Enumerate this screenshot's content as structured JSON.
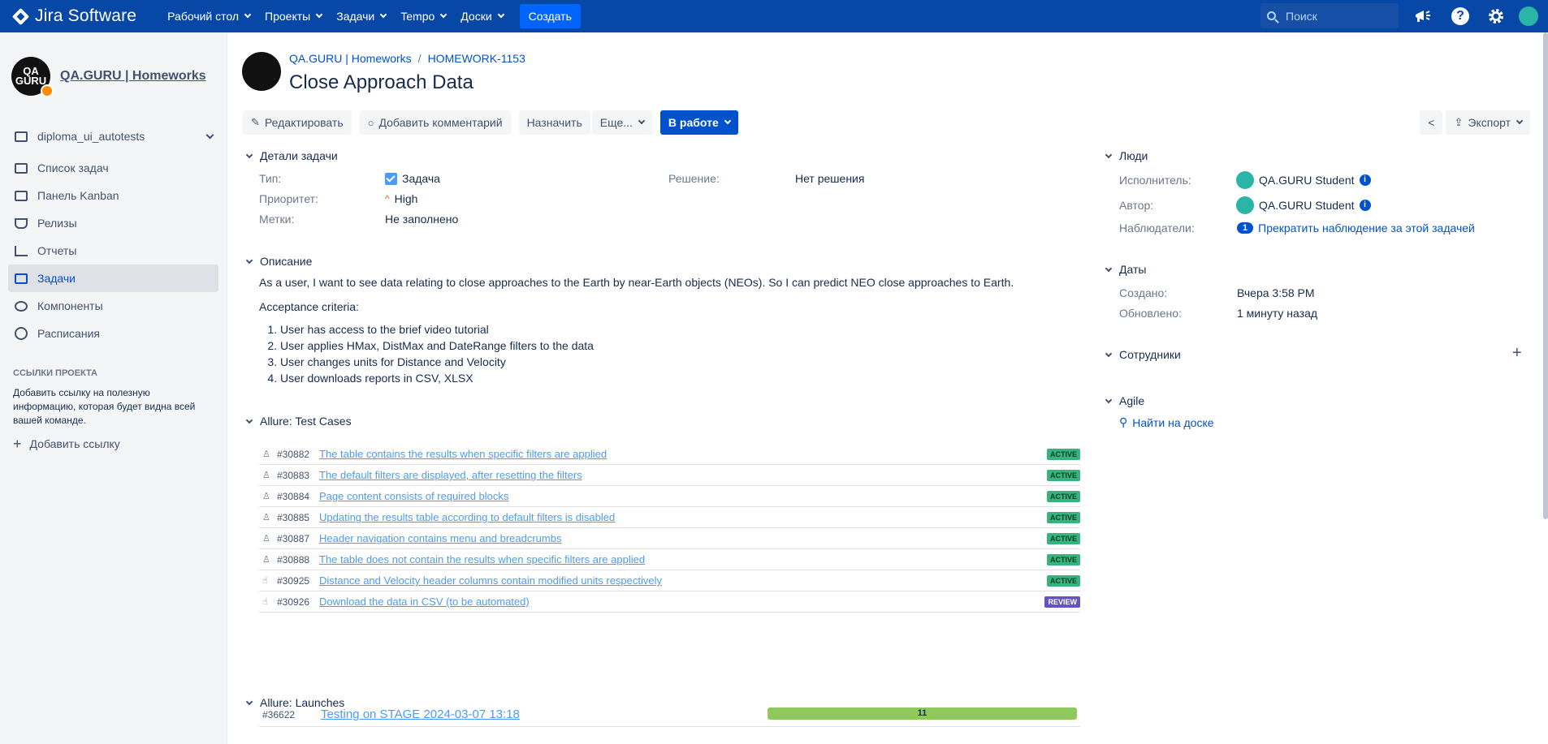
{
  "topbar": {
    "brand": "Jira Software",
    "nav": [
      "Рабочий стол",
      "Проекты",
      "Задачи",
      "Tempo",
      "Доски"
    ],
    "create_label": "Создать",
    "search_placeholder": "Поиск"
  },
  "sidebar": {
    "project_name": "QA.GURU | Homeworks",
    "board_name": "diploma_ui_autotests",
    "items": [
      {
        "label": "Список задач",
        "icon": "backlog-icon"
      },
      {
        "label": "Панель Kanban",
        "icon": "board-icon"
      },
      {
        "label": "Релизы",
        "icon": "ship-icon"
      },
      {
        "label": "Отчеты",
        "icon": "chart-icon"
      },
      {
        "label": "Задачи",
        "icon": "issues-icon",
        "active": true
      },
      {
        "label": "Компоненты",
        "icon": "puzzle-icon"
      },
      {
        "label": "Расписания",
        "icon": "clock-icon"
      }
    ],
    "links_title": "ССЫЛКИ ПРОЕКТА",
    "links_hint": "Добавить ссылку на полезную информацию, которая будет видна всей вашей команде.",
    "add_link_label": "Добавить ссылку"
  },
  "issue": {
    "breadcrumb_project": "QA.GURU | Homeworks",
    "breadcrumb_key": "HOMEWORK-1153",
    "title": "Close Approach Data"
  },
  "toolbar": {
    "edit": "Редактировать",
    "comment": "Добавить комментарий",
    "assign": "Назначить",
    "more": "Еще...",
    "status": "В работе",
    "export": "Экспорт"
  },
  "details": {
    "section_title": "Детали задачи",
    "type_label": "Тип:",
    "type_value": "Задача",
    "priority_label": "Приоритет:",
    "priority_value": "High",
    "labels_label": "Метки:",
    "labels_value": "Не заполнено",
    "resolution_label": "Решение:",
    "resolution_value": "Нет решения"
  },
  "description": {
    "section_title": "Описание",
    "intro": "As a user, I want to see data relating to close approaches to the Earth by near-Earth objects (NEOs). So I can predict NEO close approaches to Earth.",
    "criteria_title": "Acceptance criteria:",
    "criteria": [
      "User has access to the brief video tutorial",
      "User applies HMax, DistMax and DateRange filters to the data",
      "User changes units for Distance and Velocity",
      "User downloads reports in CSV, XLSX"
    ]
  },
  "test_cases": {
    "section_title": "Allure: Test Cases",
    "rows": [
      {
        "id": "#30882",
        "title": "The table contains the results when specific filters are applied",
        "status": "ACTIVE",
        "icon": "user-icon"
      },
      {
        "id": "#30883",
        "title": "The default filters are displayed, after resetting the filters",
        "status": "ACTIVE",
        "icon": "user-icon"
      },
      {
        "id": "#30884",
        "title": "Page content consists of required blocks",
        "status": "ACTIVE",
        "icon": "user-icon"
      },
      {
        "id": "#30885",
        "title": "Updating the results table according to default filters is disabled",
        "status": "ACTIVE",
        "icon": "user-icon"
      },
      {
        "id": "#30887",
        "title": "Header navigation contains menu and breadcrumbs",
        "status": "ACTIVE",
        "icon": "user-icon"
      },
      {
        "id": "#30888",
        "title": "The table does not contain the results when specific filters are applied",
        "status": "ACTIVE",
        "icon": "user-icon"
      },
      {
        "id": "#30925",
        "title": "Distance and Velocity header columns contain modified units respectively",
        "status": "ACTIVE",
        "icon": "hand-icon"
      },
      {
        "id": "#30926",
        "title": "Download the data in CSV (to be automated)",
        "status": "REVIEW",
        "icon": "hand-icon"
      }
    ]
  },
  "launches": {
    "section_title": "Allure: Launches",
    "rows": [
      {
        "id": "#36622",
        "title": "Testing on STAGE 2024-03-07 13:18",
        "count": "11"
      }
    ]
  },
  "people": {
    "section_title": "Люди",
    "assignee_label": "Исполнитель:",
    "assignee": "QA.GURU Student",
    "reporter_label": "Автор:",
    "reporter": "QA.GURU Student",
    "watchers_label": "Наблюдатели:",
    "watchers_count": "1",
    "watch_action": "Прекратить наблюдение за этой задачей"
  },
  "dates": {
    "section_title": "Даты",
    "created_label": "Создано:",
    "created": "Вчера 3:58 PM",
    "updated_label": "Обновлено:",
    "updated": "1 минуту назад"
  },
  "staff": {
    "section_title": "Сотрудники"
  },
  "agile": {
    "section_title": "Agile",
    "find_label": "Найти на доске"
  },
  "colors": {
    "topbar": "#0747a6",
    "accent": "#0052cc",
    "active": "#36b37e",
    "review": "#6554c0"
  }
}
